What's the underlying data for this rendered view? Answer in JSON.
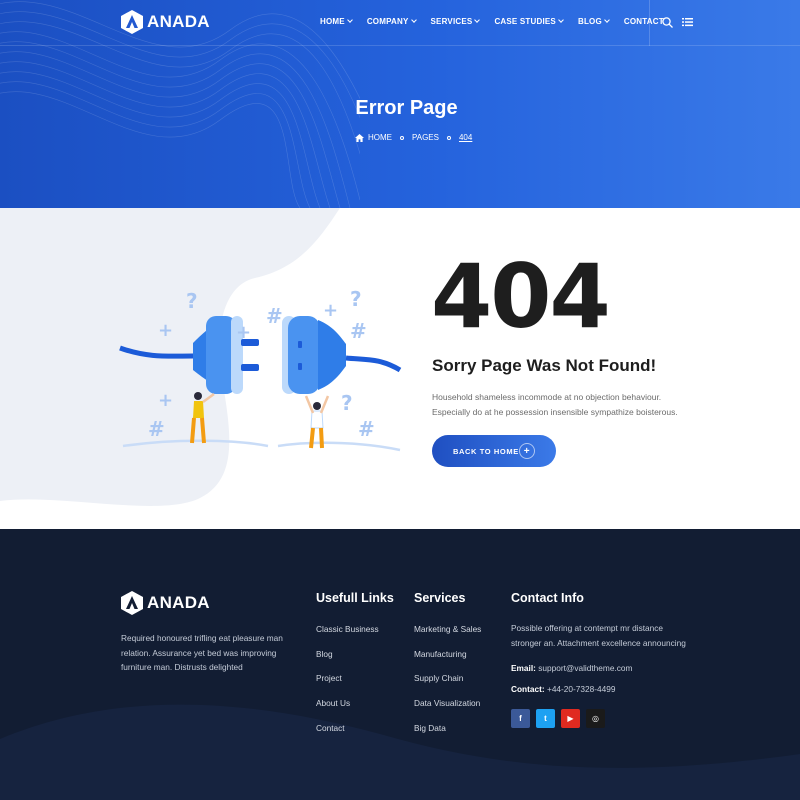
{
  "brand": {
    "name": "ANADA"
  },
  "nav": {
    "items": [
      {
        "label": "HOME",
        "has_dropdown": true
      },
      {
        "label": "COMPANY",
        "has_dropdown": true
      },
      {
        "label": "SERVICES",
        "has_dropdown": true
      },
      {
        "label": "CASE STUDIES",
        "has_dropdown": true
      },
      {
        "label": "BLOG",
        "has_dropdown": true
      },
      {
        "label": "CONTACT",
        "has_dropdown": false
      }
    ],
    "icons": [
      "search-icon",
      "list-menu-icon"
    ]
  },
  "hero": {
    "title": "Error Page",
    "breadcrumb": [
      "HOME",
      "PAGES",
      "404"
    ]
  },
  "error": {
    "code": "404",
    "heading": "Sorry Page Was Not Found!",
    "description": "Household shameless incommode at no objection behaviour. Especially do at he possession insensible sympathize boisterous.",
    "button_label": "BACK TO HOME"
  },
  "footer": {
    "about": "Required honoured trifling eat pleasure man relation. Assurance yet bed was improving furniture man. Distrusts delighted",
    "links_title": "Usefull Links",
    "links": [
      "Classic Business",
      "Blog",
      "Project",
      "About Us",
      "Contact"
    ],
    "services_title": "Services",
    "services": [
      "Marketing & Sales",
      "Manufacturing",
      "Supply Chain",
      "Data Visualization",
      "Big Data"
    ],
    "contact_title": "Contact Info",
    "contact_desc": "Possible offering at contempt mr distance stronger an. Attachment excellence announcing",
    "email_label": "Email:",
    "email": "support@validtheme.com",
    "phone_label": "Contact:",
    "phone": "+44-20-7328-4499",
    "socials": [
      {
        "name": "facebook-icon",
        "glyph": "f",
        "color": "#3b5998"
      },
      {
        "name": "twitter-icon",
        "glyph": "t",
        "color": "#1da1f2"
      },
      {
        "name": "youtube-icon",
        "glyph": "▶",
        "color": "#e02a20"
      },
      {
        "name": "instagram-icon",
        "glyph": "◎",
        "color": "#1a1a1a"
      }
    ]
  },
  "colors": {
    "primary": "#2563dd",
    "footer_bg": "#121d33",
    "text_dark": "#1e1e1e"
  }
}
